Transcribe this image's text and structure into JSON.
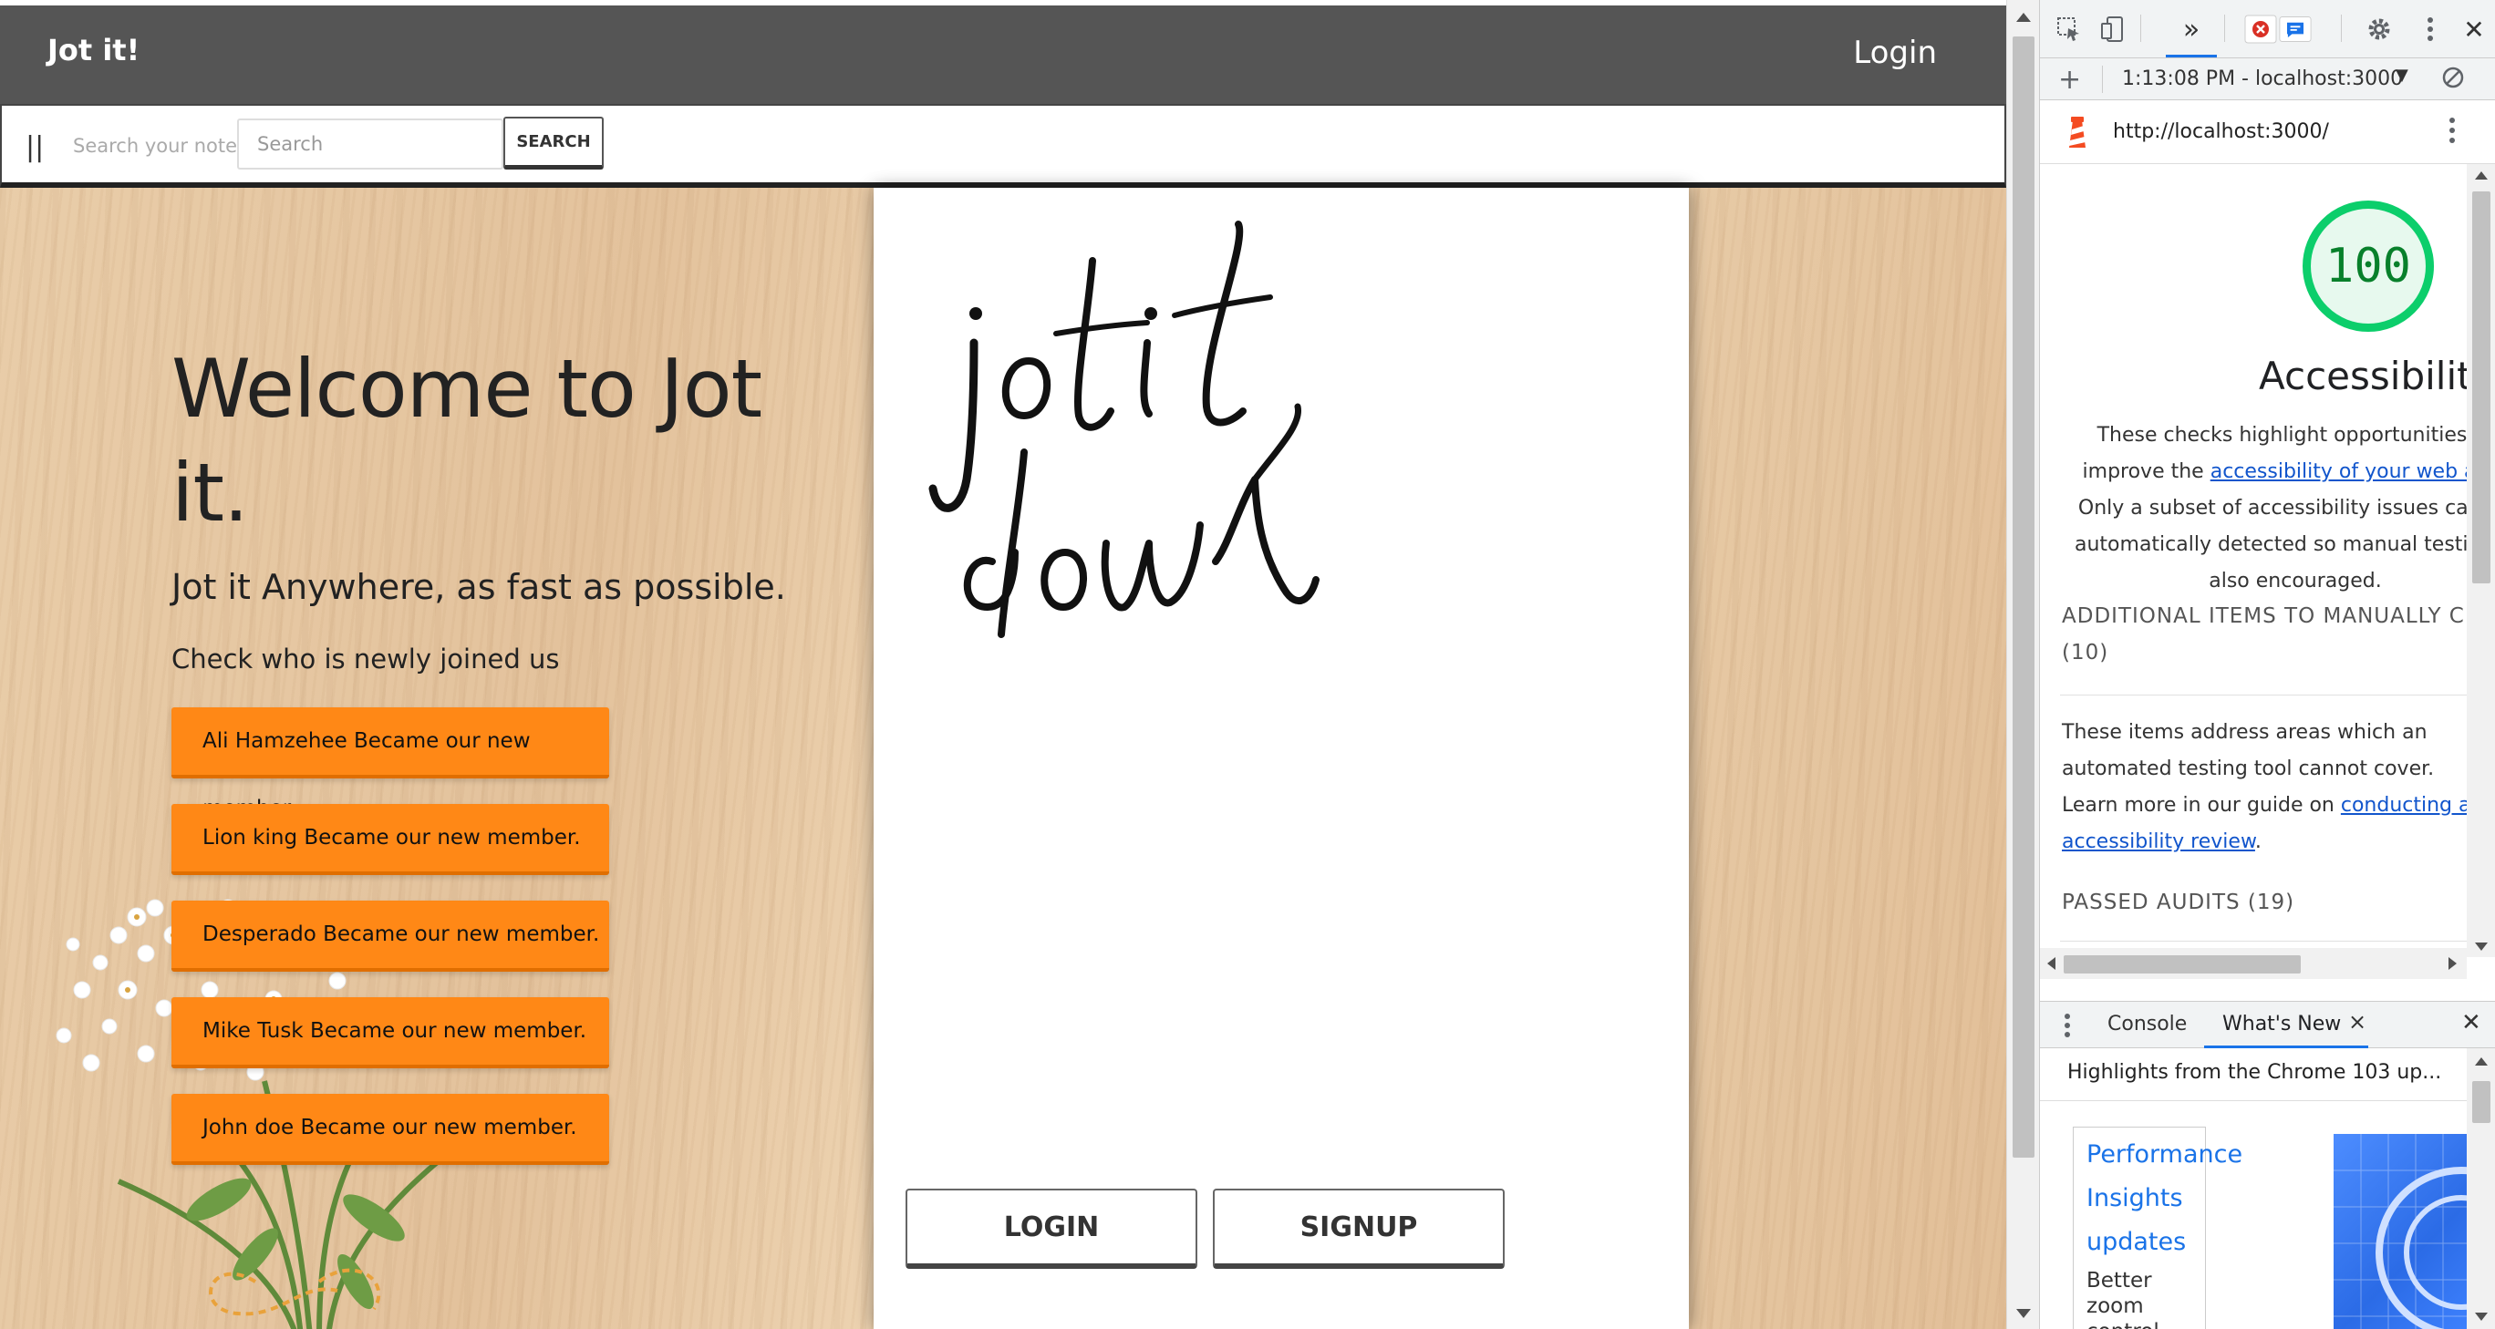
{
  "navbar": {
    "brand": "Jot it!",
    "login_label": "Login"
  },
  "searchbar": {
    "menu_glyph": "||",
    "label": "Search your notes",
    "input_placeholder": "Search",
    "button_label": "SEARCH"
  },
  "hero": {
    "title": "Welcome to Jot it.",
    "tagline": "Jot it Anywhere, as fast as possible.",
    "members_heading": "Check who is newly joined us",
    "members": [
      "Ali Hamzehee Became our new member.",
      "Lion king Became our new member.",
      "Desperado Became our new member.",
      "Mike Tusk Became our new member.",
      "John doe Became our new member."
    ]
  },
  "panel": {
    "logo_text": "jot it down",
    "login_button": "LOGIN",
    "signup_button": "SIGNUP"
  },
  "devtools": {
    "toolbar_icons": [
      "inspect-element-icon",
      "device-toolbar-icon",
      "more-tabs-icon",
      "error-badge-icon",
      "message-badge-icon",
      "settings-icon",
      "kebab-menu-icon",
      "close-icon"
    ],
    "timebar": {
      "time_origin": "1:13:08 PM - localhost:3000"
    },
    "url": "http://localhost:3000/",
    "lighthouse": {
      "score": "100",
      "category": "Accessibility",
      "desc_before": "These checks highlight opportunities to improve the ",
      "desc_link": "accessibility of your web app",
      "desc_after": ". Only a subset of accessibility issues can be automatically detected so manual testing is also encouraged.",
      "manual_heading": "ADDITIONAL ITEMS TO MANUALLY CHECK",
      "manual_count": "(10)",
      "manual_desc_before": "These items address areas which an automated testing tool cannot cover. Learn more in our guide on ",
      "manual_desc_link": "conducting an accessibility review",
      "manual_desc_after": ".",
      "passed_heading": "PASSED AUDITS",
      "passed_count": "(19)"
    },
    "drawer": {
      "tabs": [
        "Console",
        "What's New"
      ],
      "active_tab": "What's New",
      "highlights": "Highlights from the Chrome 103 up...",
      "card_title": "Performance Insights updates",
      "card_text": "Better zoom control, improved"
    }
  },
  "colors": {
    "navbar": "#555555",
    "member_button": "#ff8816",
    "score_green": "#0cce6b",
    "link_blue": "#1155cc",
    "devtools_accent": "#1a73e8"
  }
}
